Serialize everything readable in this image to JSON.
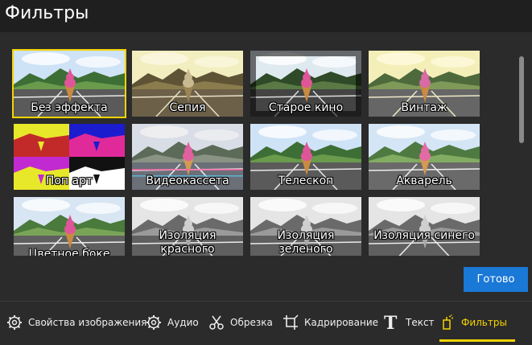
{
  "window": {
    "title": "Фильтры"
  },
  "filters": [
    {
      "label": "Без эффекта",
      "variant": "normal",
      "selected": true
    },
    {
      "label": "Сепия",
      "variant": "sepia",
      "selected": false
    },
    {
      "label": "Старое кино",
      "variant": "oldfilm",
      "selected": false
    },
    {
      "label": "Винтаж",
      "variant": "vintage",
      "selected": false
    },
    {
      "label": "Поп арт",
      "variant": "popart",
      "selected": false
    },
    {
      "label": "Видеокассета",
      "variant": "vhs",
      "selected": false
    },
    {
      "label": "Телескоп",
      "variant": "normal",
      "selected": false
    },
    {
      "label": "Акварель",
      "variant": "watercolor",
      "selected": false
    },
    {
      "label": "Цветное боке",
      "variant": "bokeh",
      "selected": false
    },
    {
      "label": "Изоляция\nкрасного",
      "variant": "isolate",
      "selected": false
    },
    {
      "label": "Изоляция\nзеленого",
      "variant": "isolate",
      "selected": false
    },
    {
      "label": "Изоляция синего",
      "variant": "isolate",
      "selected": false
    }
  ],
  "done_button": {
    "label": "Готово"
  },
  "tabs": [
    {
      "label": "Свойства изображения",
      "icon": "image-settings-icon"
    },
    {
      "label": "Аудио",
      "icon": "audio-gear-icon"
    },
    {
      "label": "Обрезка",
      "icon": "scissors-icon"
    },
    {
      "label": "Кадрирование",
      "icon": "crop-icon"
    },
    {
      "label": "Текст",
      "icon": "text-icon"
    },
    {
      "label": "Фильтры",
      "icon": "filters-icon",
      "active": true
    }
  ],
  "colors": {
    "accent": "#f5d400",
    "button": "#1a78d6",
    "background": "#2b2b2b",
    "titlebar": "#1f1f1f"
  }
}
